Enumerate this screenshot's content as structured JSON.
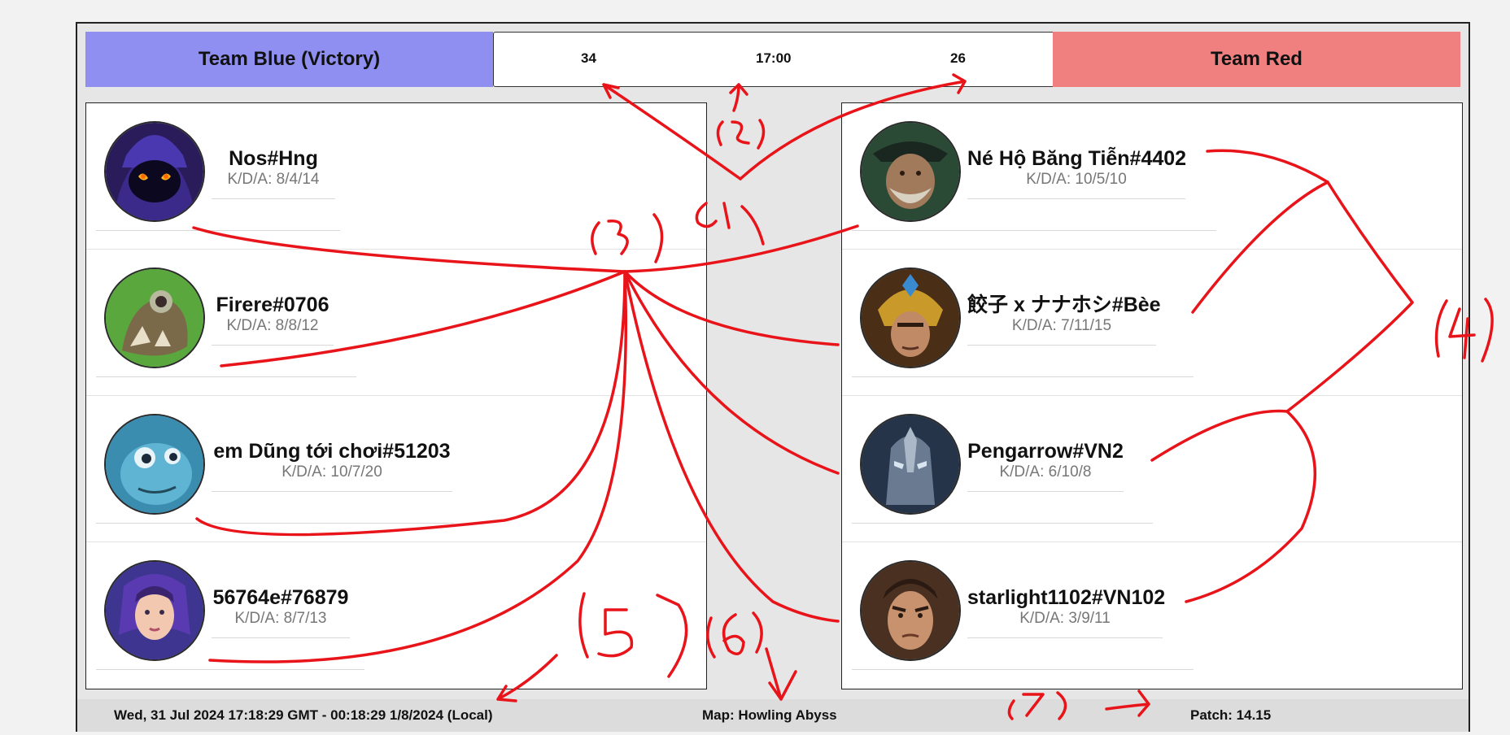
{
  "header": {
    "team_blue": "Team Blue (Victory)",
    "team_red": "Team Red",
    "score_blue": "34",
    "timer": "17:00",
    "score_red": "26"
  },
  "blue_players": [
    {
      "name": "Nos#Hng",
      "kda": "K/D/A: 8/4/14",
      "champion_icon": "veigar-portrait"
    },
    {
      "name": "Firere#0706",
      "kda": "K/D/A: 8/8/12",
      "champion_icon": "twitch-portrait"
    },
    {
      "name": "em Dũng tới chơi#51203",
      "kda": "K/D/A: 10/7/20",
      "champion_icon": "fizz-portrait"
    },
    {
      "name": "56764e#76879",
      "kda": "K/D/A: 8/7/13",
      "champion_icon": "irelia-portrait"
    }
  ],
  "red_players": [
    {
      "name": "Né Hộ Băng Tiễn#4402",
      "kda": "K/D/A: 10/5/10",
      "champion_icon": "gangplank-portrait"
    },
    {
      "name": "餃子 x ナナホシ#Bèe",
      "kda": "K/D/A: 7/11/15",
      "champion_icon": "jarvan-portrait"
    },
    {
      "name": "Pengarrow#VN2",
      "kda": "K/D/A: 6/10/8",
      "champion_icon": "malphite-portrait"
    },
    {
      "name": "starlight1102#VN102",
      "kda": "K/D/A: 3/9/11",
      "champion_icon": "jayce-portrait"
    }
  ],
  "footer": {
    "datetime": "Wed, 31 Jul 2024 17:18:29 GMT - 00:18:29 1/8/2024 (Local)",
    "map": "Map: Howling Abyss",
    "patch": "Patch: 14.15"
  },
  "colors": {
    "team_blue": "#8e8ff0",
    "team_red": "#f07f7f",
    "annotation_ink": "#e8141a"
  }
}
